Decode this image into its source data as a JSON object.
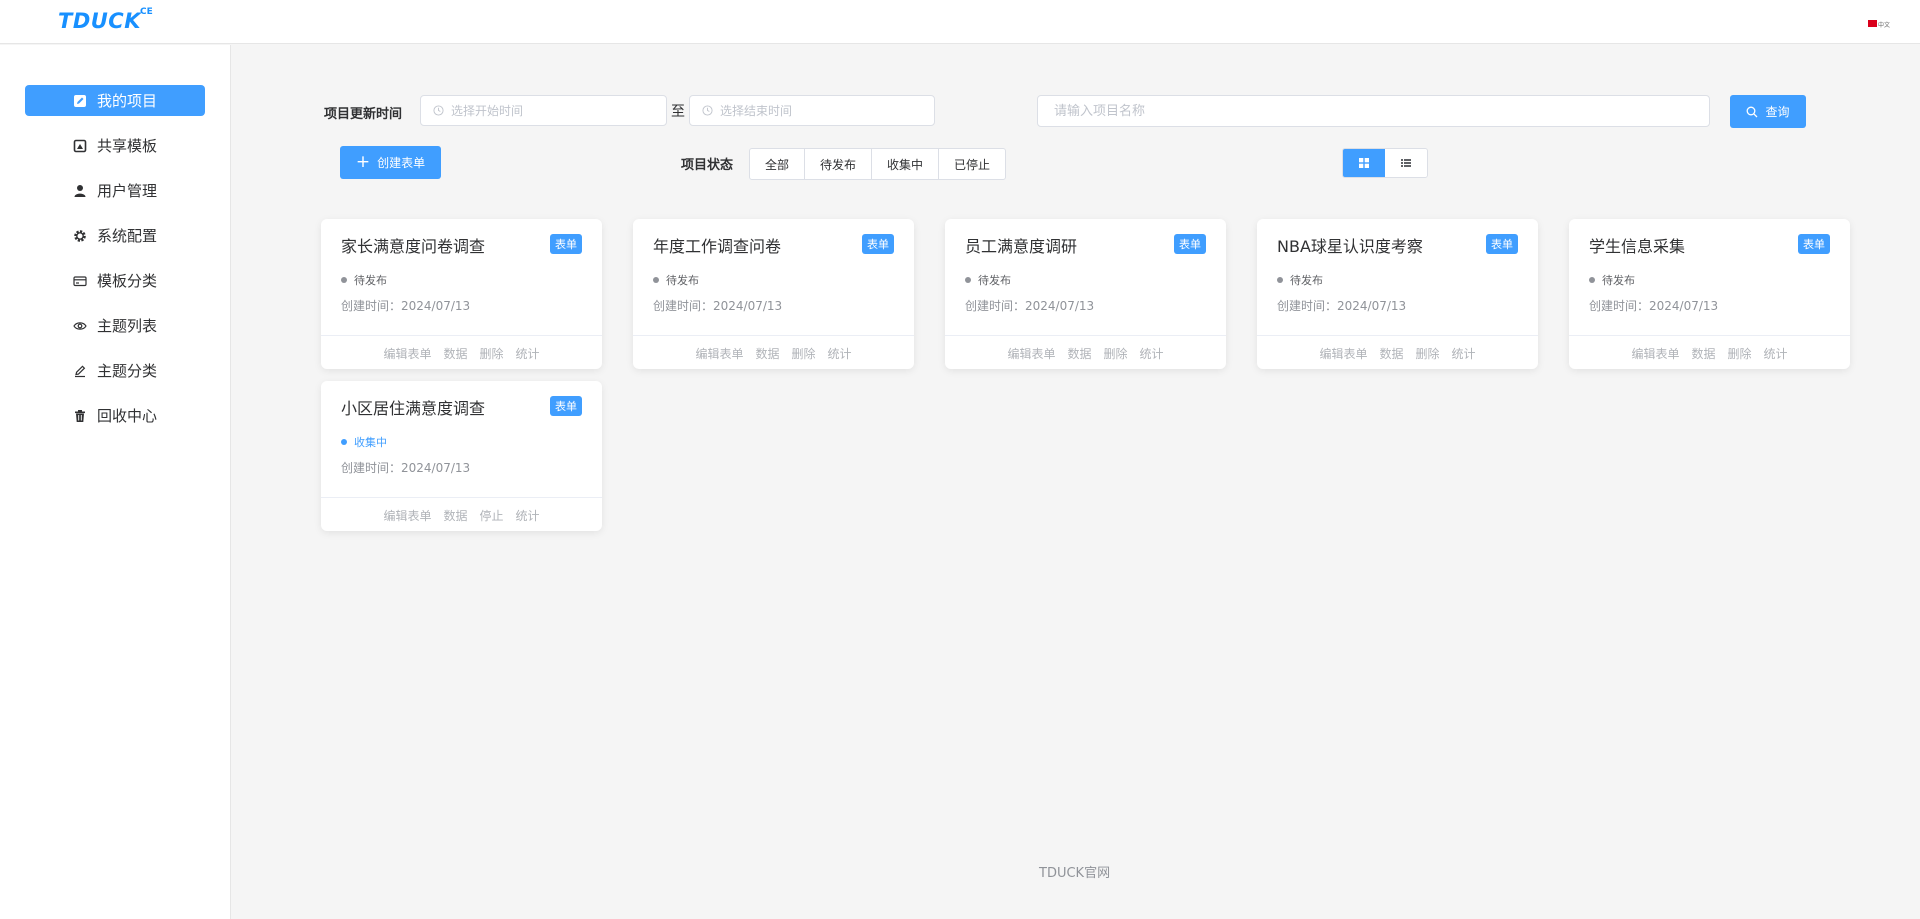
{
  "header": {
    "logo": "TDUCK",
    "logo_sup": "CE",
    "lang": "中文"
  },
  "sidebar": {
    "items": [
      {
        "label": "我的项目",
        "icon": "edit-icon",
        "active": true
      },
      {
        "label": "共享模板",
        "icon": "template-icon",
        "active": false
      },
      {
        "label": "用户管理",
        "icon": "user-icon",
        "active": false
      },
      {
        "label": "系统配置",
        "icon": "gear-icon",
        "active": false
      },
      {
        "label": "模板分类",
        "icon": "card-icon",
        "active": false
      },
      {
        "label": "主题列表",
        "icon": "eye-icon",
        "active": false
      },
      {
        "label": "主题分类",
        "icon": "pen-icon",
        "active": false
      },
      {
        "label": "回收中心",
        "icon": "trash-icon",
        "active": false
      }
    ]
  },
  "filters": {
    "update_time_label": "项目更新时间",
    "start_placeholder": "选择开始时间",
    "separator": "至",
    "end_placeholder": "选择结束时间",
    "search_placeholder": "请输入项目名称",
    "query_label": "查询",
    "create_label": "创建表单",
    "status_label": "项目状态",
    "status_options": [
      "全部",
      "待发布",
      "收集中",
      "已停止"
    ]
  },
  "cards": [
    {
      "title": "家长满意度问卷调查",
      "tag": "表单",
      "status": "待发布",
      "status_key": "pending",
      "date": "创建时间：2024/07/13",
      "actions": [
        "编辑表单",
        "数据",
        "删除",
        "统计"
      ]
    },
    {
      "title": "年度工作调查问卷",
      "tag": "表单",
      "status": "待发布",
      "status_key": "pending",
      "date": "创建时间：2024/07/13",
      "actions": [
        "编辑表单",
        "数据",
        "删除",
        "统计"
      ]
    },
    {
      "title": "员工满意度调研",
      "tag": "表单",
      "status": "待发布",
      "status_key": "pending",
      "date": "创建时间：2024/07/13",
      "actions": [
        "编辑表单",
        "数据",
        "删除",
        "统计"
      ]
    },
    {
      "title": "NBA球星认识度考察",
      "tag": "表单",
      "status": "待发布",
      "status_key": "pending",
      "date": "创建时间：2024/07/13",
      "actions": [
        "编辑表单",
        "数据",
        "删除",
        "统计"
      ]
    },
    {
      "title": "学生信息采集",
      "tag": "表单",
      "status": "待发布",
      "status_key": "pending",
      "date": "创建时间：2024/07/13",
      "actions": [
        "编辑表单",
        "数据",
        "删除",
        "统计"
      ]
    },
    {
      "title": "小区居住满意度调查",
      "tag": "表单",
      "status": "收集中",
      "status_key": "collecting",
      "date": "创建时间：2024/07/13",
      "actions": [
        "编辑表单",
        "数据",
        "停止",
        "统计"
      ]
    }
  ],
  "footer": {
    "text": "TDUCK官网"
  },
  "colors": {
    "primary": "#409eff",
    "pending_dot": "#909399",
    "collecting": "#409eff"
  }
}
